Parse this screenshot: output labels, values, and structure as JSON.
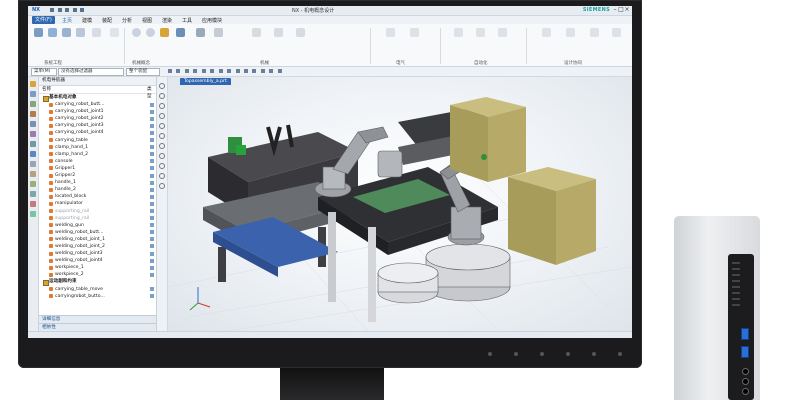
{
  "titlebar": {
    "app_logo": "NX",
    "title": "NX - 机电概念设计",
    "brand": "SIEMENS",
    "minimize": "–",
    "maximize": "□",
    "close": "×"
  },
  "menu": {
    "file": "文件(F)",
    "items": [
      "主页",
      "建模",
      "装配",
      "分析",
      "视图",
      "渲染",
      "工具",
      "应用模块"
    ]
  },
  "ribbon": {
    "groups": [
      "系统工程",
      "机械概念",
      "机械",
      "电气",
      "自动化",
      "设计协同"
    ]
  },
  "cmdbar": {
    "menu_label": "菜单(M)",
    "filter_value": "没有选择过滤器",
    "scope_value": "整个装配"
  },
  "navigator": {
    "header": "机电导航器",
    "col_name": "名称",
    "col_type": "类型",
    "root": "基本机电对象",
    "items": [
      "carrying_robot_butt...",
      "carrying_robot_joint1",
      "carrying_robot_joint2",
      "carrying_robot_joint3",
      "carrying_robot_joint4",
      "carrying_table",
      "clamp_hand_1",
      "clamp_hand_2",
      "console",
      "Gripper1",
      "Gripper2",
      "handle_1",
      "handle_2",
      "located_block",
      "manipulator",
      "supporting_rail",
      "supporting_rail",
      "welding_gun",
      "welding_robot_butt...",
      "welding_robot_joint_1",
      "welding_robot_joint_2",
      "welding_robot_joint3",
      "welding_robot_joint4",
      "workpiece_1",
      "workpiece_2"
    ],
    "group2": "运动副和约束",
    "items2": [
      "carrying_table_move",
      "carryingrobot_butto..."
    ],
    "footer1": "详细信息",
    "footer2": "相依性"
  },
  "viewport": {
    "tab_label": "Topassembly_a.prt"
  },
  "colors": {
    "accent": "#2f67b1",
    "brand": "#1b9e9e"
  }
}
